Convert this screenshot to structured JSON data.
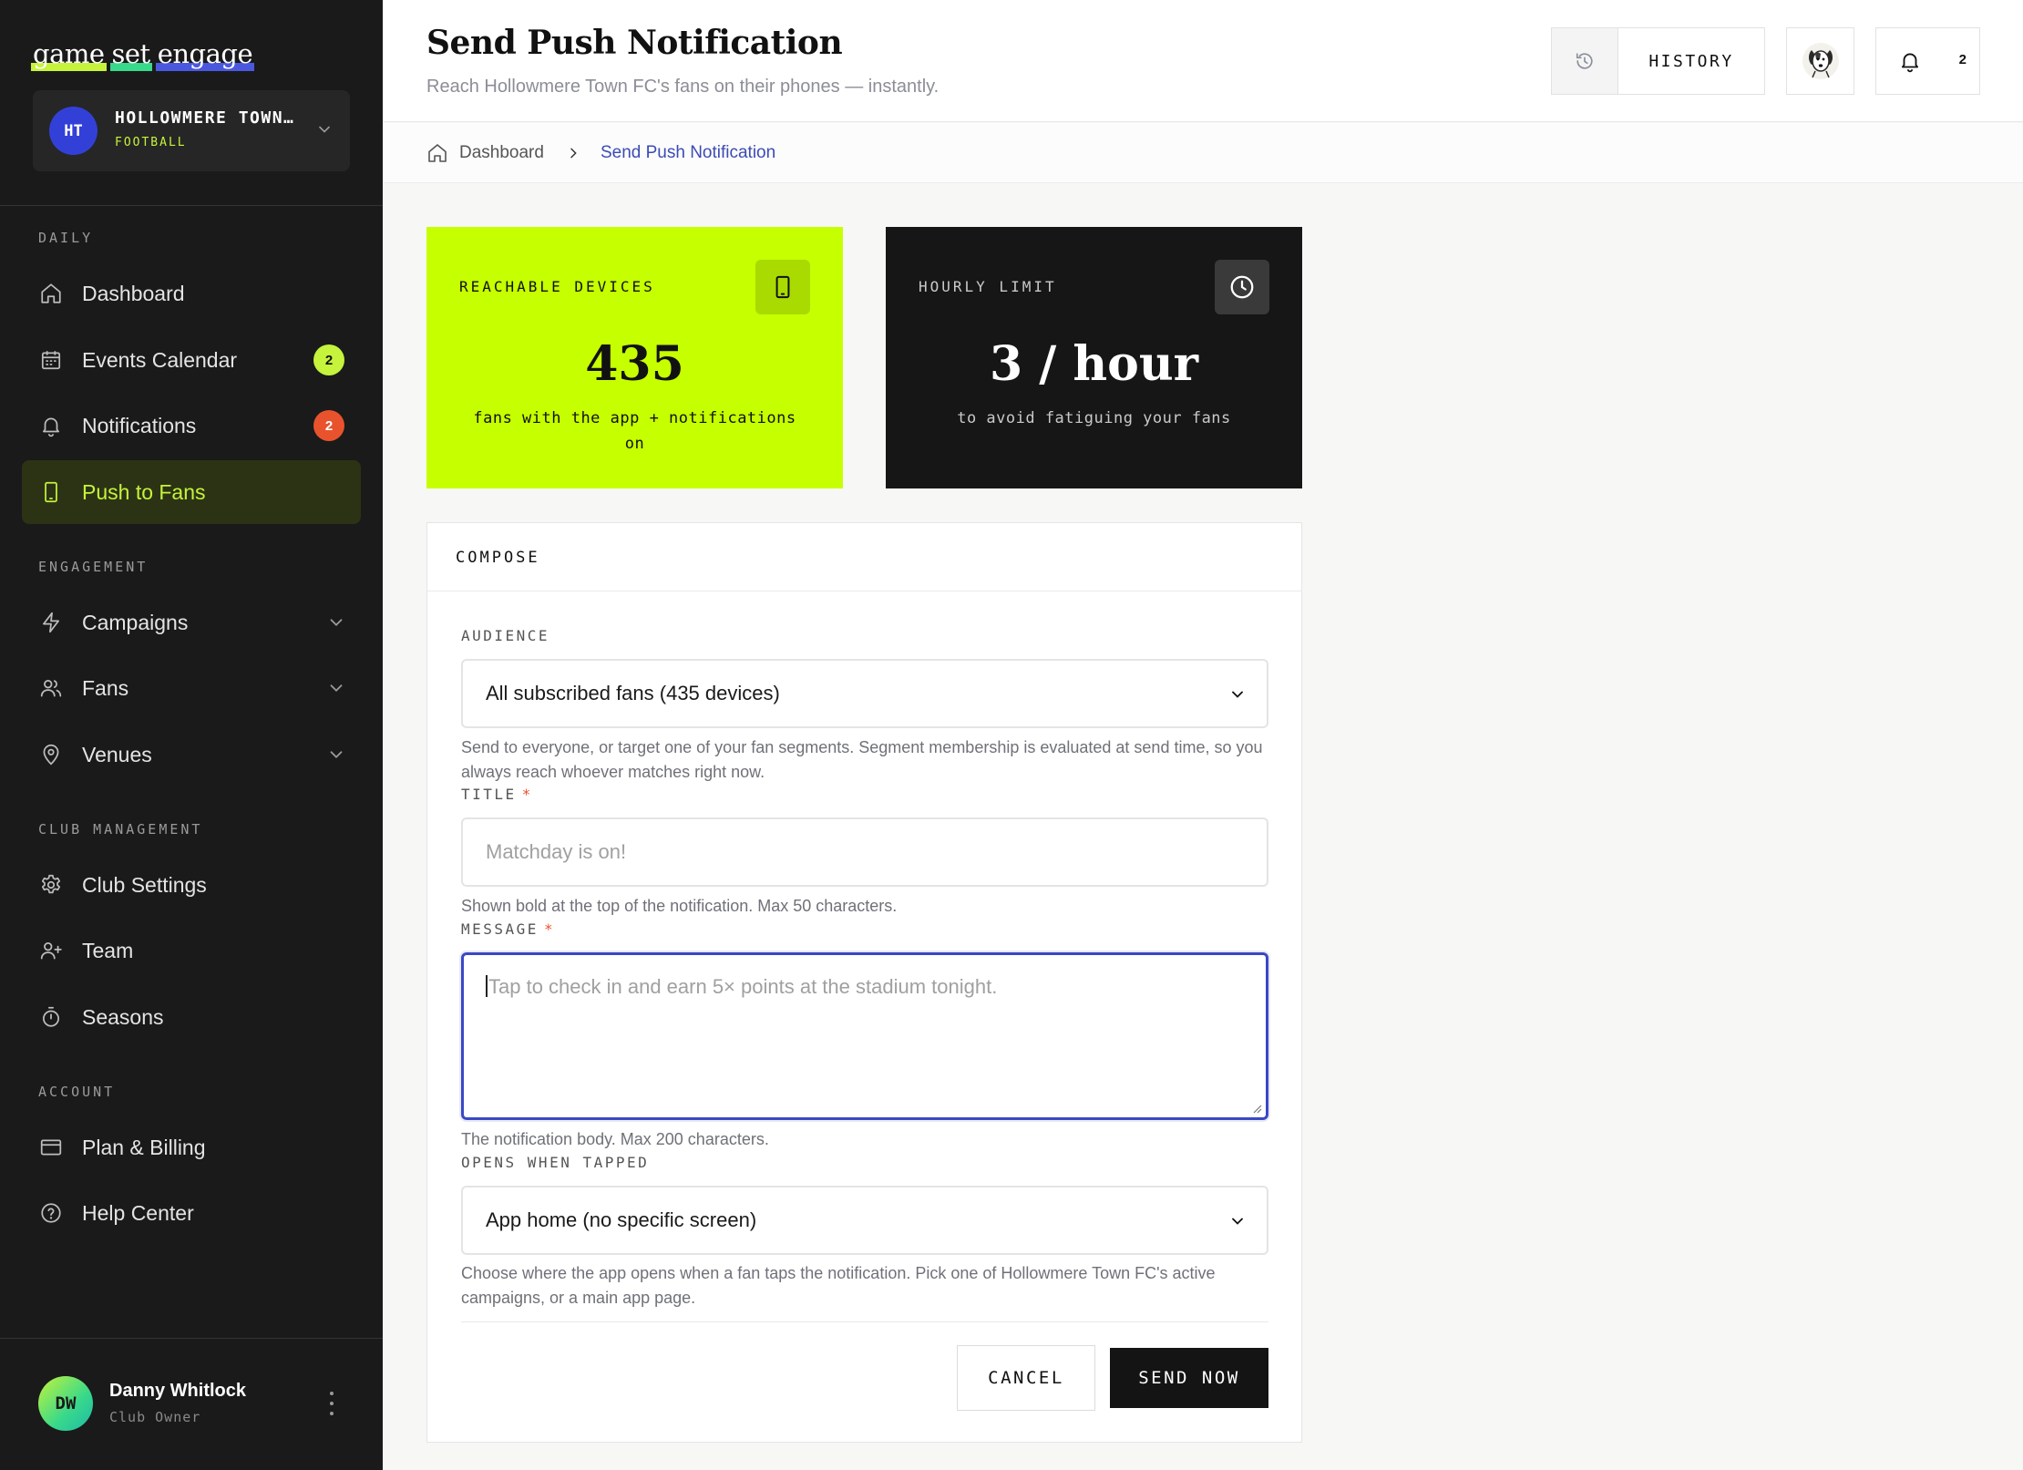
{
  "sidebar": {
    "logo": {
      "words": [
        "game",
        "set",
        "engage"
      ],
      "colors": [
        "#c6f33b",
        "#38d98a",
        "#4a58e0"
      ]
    },
    "club": {
      "initials": "HT",
      "name": "HOLLOWMERE TOWN…",
      "sport": "FOOTBALL"
    },
    "sections": {
      "daily": "DAILY",
      "engagement": "ENGAGEMENT",
      "club_management": "CLUB MANAGEMENT",
      "account": "ACCOUNT"
    },
    "items": {
      "dashboard": {
        "label": "Dashboard",
        "icon": "home-icon"
      },
      "events": {
        "label": "Events Calendar",
        "icon": "calendar-icon",
        "badge": "2"
      },
      "notifications": {
        "label": "Notifications",
        "icon": "bell-icon",
        "badge": "2"
      },
      "push": {
        "label": "Push to Fans",
        "icon": "phone-icon",
        "active": true
      },
      "campaigns": {
        "label": "Campaigns",
        "icon": "lightning-icon"
      },
      "fans": {
        "label": "Fans",
        "icon": "users-icon"
      },
      "venues": {
        "label": "Venues",
        "icon": "map-pin-icon"
      },
      "club_settings": {
        "label": "Club Settings",
        "icon": "gear-icon"
      },
      "team": {
        "label": "Team",
        "icon": "user-plus-icon"
      },
      "seasons": {
        "label": "Seasons",
        "icon": "stopwatch-icon"
      },
      "billing": {
        "label": "Plan & Billing",
        "icon": "credit-card-icon"
      },
      "help": {
        "label": "Help Center",
        "icon": "help-circle-icon"
      }
    },
    "user": {
      "initials": "DW",
      "name": "Danny Whitlock",
      "role": "Club Owner"
    }
  },
  "header": {
    "title": "Send Push Notification",
    "subtitle": "Reach Hollowmere Town FC's fans on their phones — instantly.",
    "history_label": "HISTORY",
    "notification_count": "2"
  },
  "breadcrumb": {
    "home": "Dashboard",
    "current": "Send Push Notification"
  },
  "stats": {
    "reachable": {
      "label": "REACHABLE DEVICES",
      "value": "435",
      "note": "fans with the app + notifications on"
    },
    "hourly": {
      "label": "HOURLY LIMIT",
      "value": "3 / hour",
      "note": "to avoid fatiguing your fans"
    }
  },
  "compose": {
    "title": "COMPOSE",
    "audience": {
      "label": "AUDIENCE",
      "value": "All subscribed fans (435 devices)",
      "help": "Send to everyone, or target one of your fan segments. Segment membership is evaluated at send time, so you always reach whoever matches right now."
    },
    "title_field": {
      "label": "TITLE",
      "required": "*",
      "placeholder": "Matchday is on!",
      "help": "Shown bold at the top of the notification. Max 50 characters."
    },
    "message": {
      "label": "MESSAGE",
      "required": "*",
      "placeholder": "Tap to check in and earn 5× points at the stadium tonight.",
      "help": "The notification body. Max 200 characters."
    },
    "opens": {
      "label": "OPENS WHEN TAPPED",
      "value": "App home (no specific screen)",
      "help": "Choose where the app opens when a fan taps the notification. Pick one of Hollowmere Town FC's active campaigns, or a main app page."
    },
    "cancel_label": "CANCEL",
    "send_label": "SEND NOW"
  },
  "colors": {
    "accent_lime": "#c6ff00",
    "accent_blue": "#3a48c4",
    "badge_red": "#e8532d",
    "sidebar_bg": "#1a1a1a"
  }
}
